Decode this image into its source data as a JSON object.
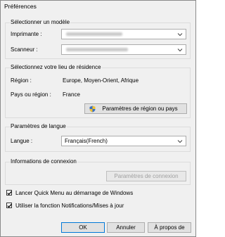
{
  "window": {
    "title": "Préférences"
  },
  "model_group": {
    "legend": "Sélectionner un modèle",
    "printer_label": "Imprimante :",
    "scanner_label": "Scanneur :"
  },
  "residence_group": {
    "legend": "Sélectionnez votre lieu de résidence",
    "region_label": "Région :",
    "region_value": "Europe, Moyen-Orient, Afrique",
    "country_label": "Pays ou région :",
    "country_value": "France",
    "settings_button": "Paramètres de région ou pays"
  },
  "language_group": {
    "legend": "Paramètres de langue",
    "language_label": "Langue :",
    "language_value": "Français(French)"
  },
  "connection_group": {
    "legend": "Informations de connexion",
    "settings_button": "Paramètres de connexion"
  },
  "options": {
    "launch_quick_menu": {
      "label": "Lancer Quick Menu au démarrage de Windows",
      "checked": true
    },
    "use_notifications": {
      "label": "Utiliser la fonction Notifications/Mises à jour",
      "checked": true
    }
  },
  "footer": {
    "ok": "OK",
    "cancel": "Annuler",
    "about": "À propos de"
  },
  "icons": {
    "shield": "shield-icon",
    "chevron": "chevron-down-icon",
    "check": "checkmark-icon"
  }
}
